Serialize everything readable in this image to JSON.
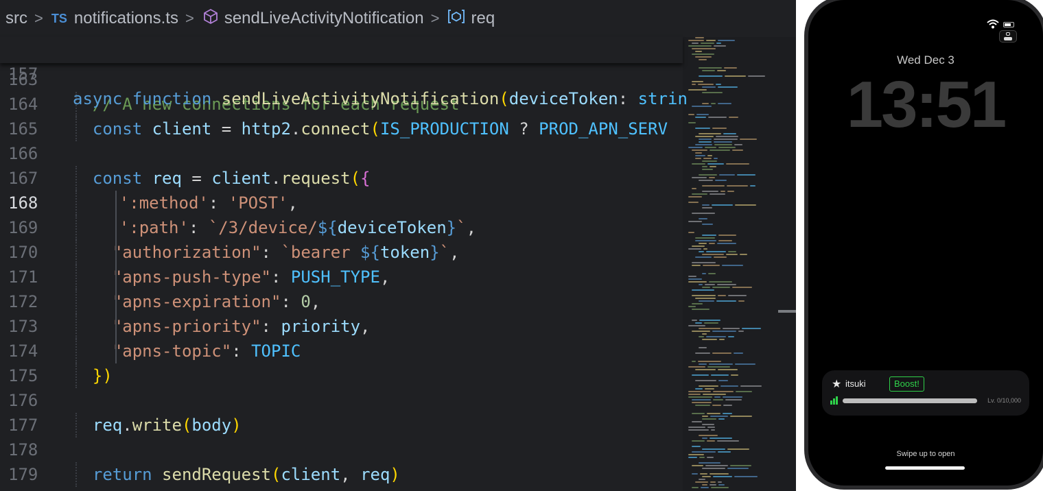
{
  "breadcrumb": {
    "folder": "src",
    "file_badge": "TS",
    "file": "notifications.ts",
    "function": "sendLiveActivityNotification",
    "symbol": "req"
  },
  "sticky": {
    "line_no": "157",
    "code": "async function sendLiveActivityNotification(deviceToken: strin"
  },
  "lines": [
    {
      "n": "163",
      "code": ""
    },
    {
      "n": "164",
      "code": "// A new connections for each request"
    },
    {
      "n": "165",
      "code": "const client = http2.connect(IS_PRODUCTION ? PROD_APN_SERV"
    },
    {
      "n": "166",
      "code": ""
    },
    {
      "n": "167",
      "code": "const req = client.request({"
    },
    {
      "n": "168",
      "code": "':method': 'POST',"
    },
    {
      "n": "169",
      "code": "':path': `/3/device/${deviceToken}`,"
    },
    {
      "n": "170",
      "code": "\"authorization\": `bearer ${token}`,"
    },
    {
      "n": "171",
      "code": "\"apns-push-type\": PUSH_TYPE,"
    },
    {
      "n": "172",
      "code": "\"apns-expiration\": 0,"
    },
    {
      "n": "173",
      "code": "\"apns-priority\": priority,"
    },
    {
      "n": "174",
      "code": "\"apns-topic\": TOPIC"
    },
    {
      "n": "175",
      "code": "})"
    },
    {
      "n": "176",
      "code": ""
    },
    {
      "n": "177",
      "code": "req.write(body)"
    },
    {
      "n": "178",
      "code": ""
    },
    {
      "n": "179",
      "code": "return sendRequest(client, req)"
    }
  ],
  "active_line": "168",
  "colors": {
    "keyword": "#569cd6",
    "function": "#dcdcaa",
    "variable": "#9cdcfe",
    "constant": "#4fc1ff",
    "string": "#ce9178",
    "number": "#b5cea8",
    "comment": "#6a9955",
    "accent_green": "#2fd24a"
  },
  "lockscreen": {
    "date": "Wed Dec 3",
    "time": "13:51",
    "activity": {
      "name": "itsuki",
      "boost_label": "Boost!",
      "progress": 1.0,
      "level_text": "Lv. 0/10,000"
    },
    "swipe_text": "Swipe up to open"
  }
}
